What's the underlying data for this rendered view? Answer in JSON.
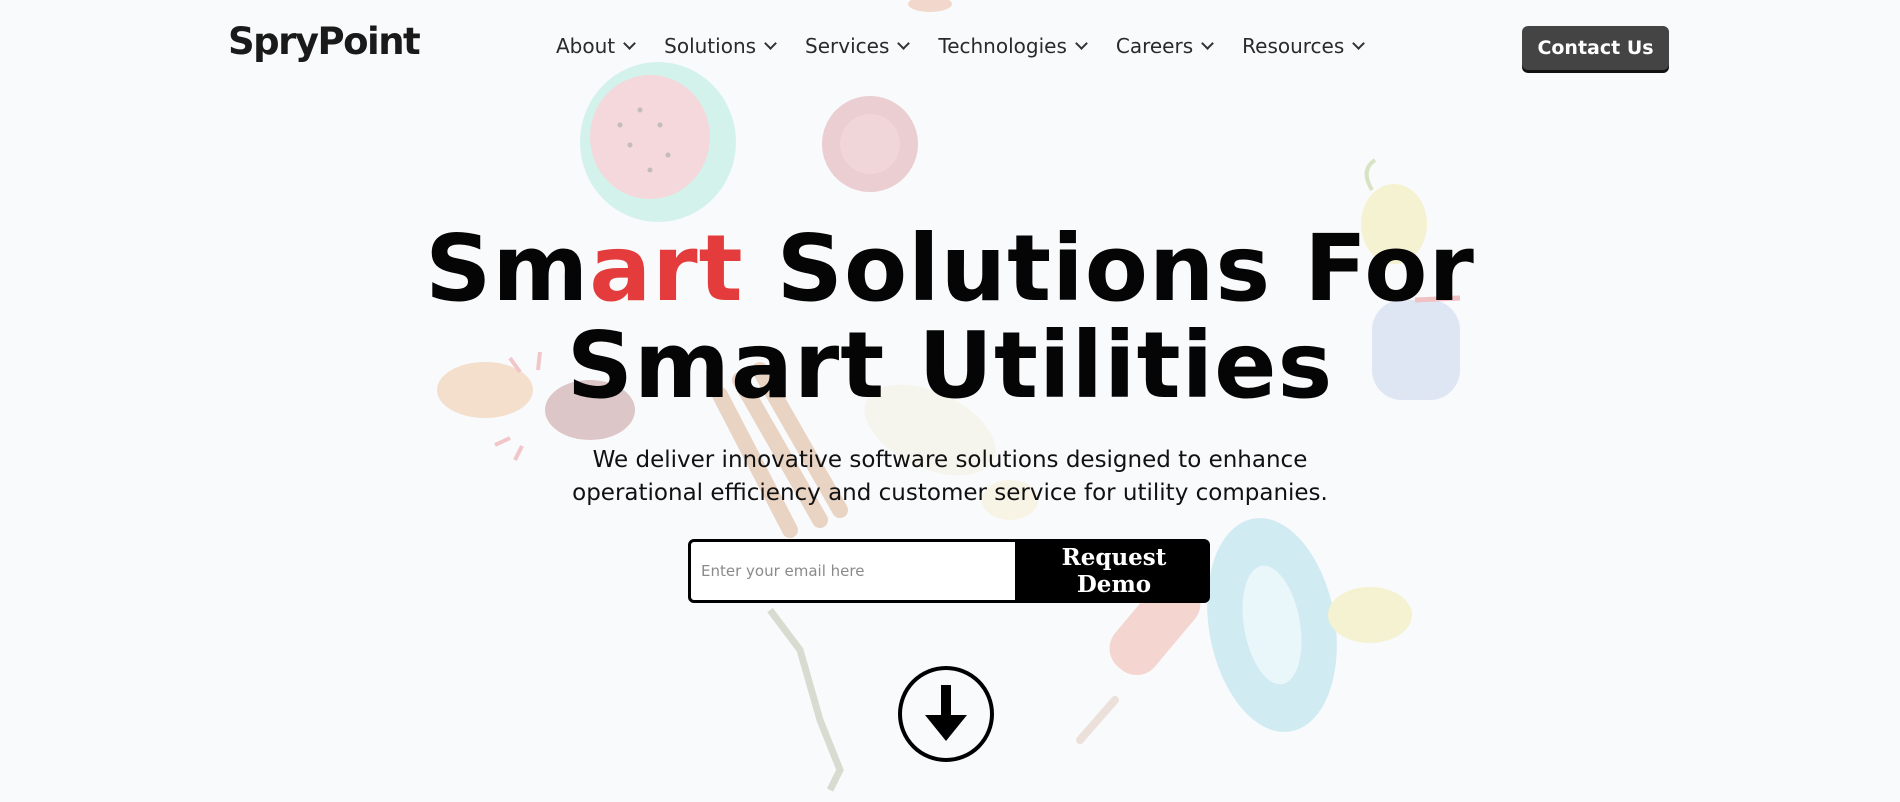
{
  "brand": {
    "name_part1": "Spry",
    "name_part2": "Point"
  },
  "nav": {
    "items": [
      {
        "label": "About"
      },
      {
        "label": "Solutions"
      },
      {
        "label": "Services"
      },
      {
        "label": "Technologies"
      },
      {
        "label": "Careers"
      },
      {
        "label": "Resources"
      }
    ],
    "contact_label": "Contact Us"
  },
  "hero": {
    "headline_pre": "Sm",
    "headline_accent": "art",
    "headline_line1_rest": " Solutions For",
    "headline_line2": "Smart Utilities",
    "subtext_line1": "We deliver innovative software solutions designed to enhance",
    "subtext_line2": "operational efficiency and customer service for utility companies.",
    "email_placeholder": "Enter your email here",
    "email_value": "",
    "demo_label": "Request Demo",
    "scroll_icon": "arrow-down-icon"
  },
  "colors": {
    "accent": "#e43c3c",
    "contact_bg": "#444444",
    "demo_bg": "#000000",
    "page_bg": "#f8f9fb"
  }
}
